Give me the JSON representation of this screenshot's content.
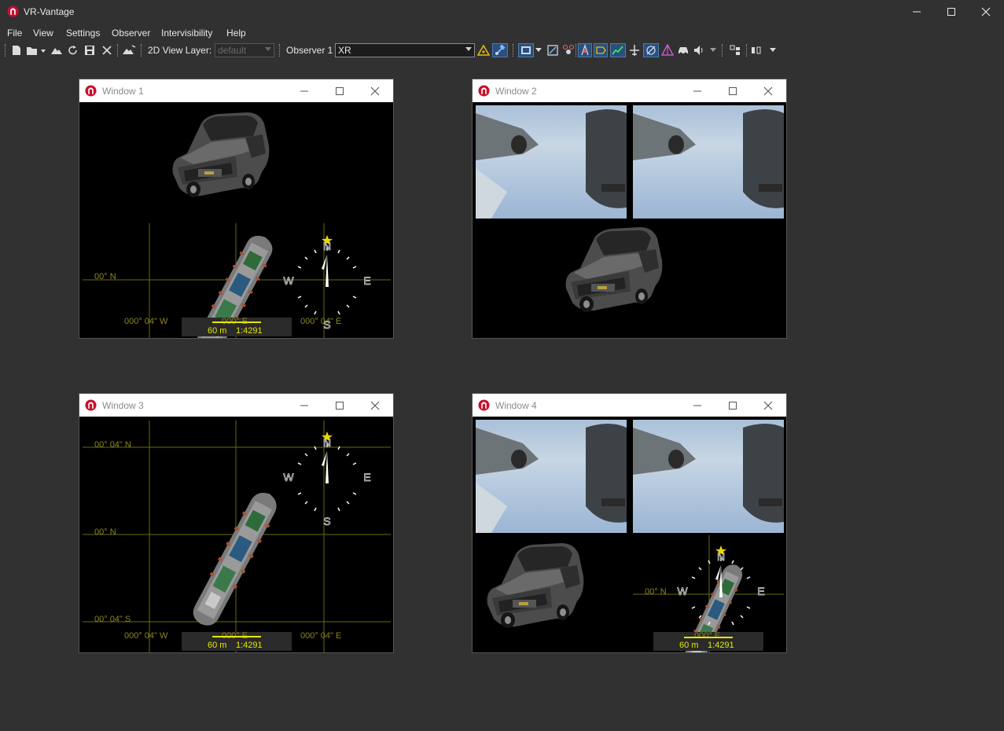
{
  "app": {
    "title": "VR-Vantage"
  },
  "menu": [
    "File",
    "View",
    "Settings",
    "Observer",
    "Intervisibility",
    "Help"
  ],
  "toolbar": {
    "view_layer_label": "2D View Layer:",
    "view_layer_value": "default",
    "observer_label": "Observer 1",
    "observer_value": "XR"
  },
  "windows": [
    {
      "title": "Window 1",
      "map": {
        "lat_labels": [
          "00° N"
        ],
        "lon_labels": [
          "000° 04\" W",
          "000° E",
          "000° 04\" E"
        ],
        "scale": "60 m",
        "ratio": "1:4291",
        "compass": {
          "n": "N",
          "e": "E",
          "s": "S",
          "w": "W"
        }
      }
    },
    {
      "title": "Window 2"
    },
    {
      "title": "Window 3",
      "map": {
        "lat_labels": [
          "00° 04\" N",
          "00° N",
          "00° 04\" S"
        ],
        "lon_labels": [
          "000° 04\" W",
          "000° E",
          "000° 04\" E"
        ],
        "scale": "60 m",
        "ratio": "1:4291",
        "compass": {
          "n": "N",
          "e": "E",
          "s": "S",
          "w": "W"
        }
      }
    },
    {
      "title": "Window 4",
      "map": {
        "lat_labels": [
          "00° N"
        ],
        "lon_labels": [
          "000° E"
        ],
        "scale": "60 m",
        "ratio": "1:4291",
        "compass": {
          "n": "N",
          "e": "E",
          "w": "W"
        }
      }
    }
  ],
  "colors": {
    "background": "#323132",
    "grid": "#6b6a10",
    "scale_text": "#e7e700",
    "map_label": "#8d8520"
  }
}
